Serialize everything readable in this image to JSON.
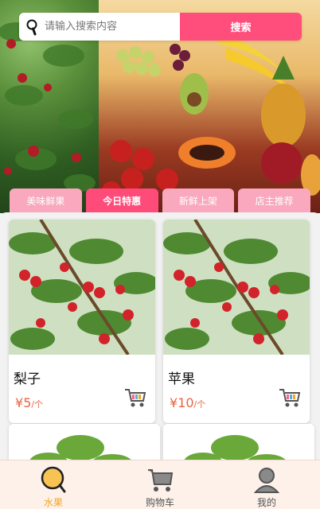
{
  "search": {
    "placeholder": "请输入搜索内容",
    "button_label": "搜索"
  },
  "tabs": [
    {
      "label": "美味鲜果",
      "active": false
    },
    {
      "label": "今日特惠",
      "active": true
    },
    {
      "label": "新鲜上架",
      "active": false
    },
    {
      "label": "店主推荐",
      "active": false
    }
  ],
  "products": [
    {
      "name": "梨子",
      "currency": "¥",
      "price": "5",
      "unit": "/个"
    },
    {
      "name": "苹果",
      "currency": "¥",
      "price": "10",
      "unit": "/个"
    }
  ],
  "bottom_nav": [
    {
      "label": "水果",
      "icon": "fruit-icon",
      "active": true
    },
    {
      "label": "购物车",
      "icon": "cart-icon",
      "active": false
    },
    {
      "label": "我的",
      "icon": "user-icon",
      "active": false
    }
  ],
  "colors": {
    "accent": "#ff4e7c",
    "tab_inactive": "#f9a8bd",
    "price": "#e96440",
    "nav_active": "#f5a623",
    "nav_bg": "#fdf1ea"
  }
}
